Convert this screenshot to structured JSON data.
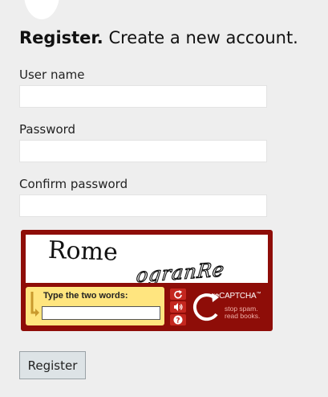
{
  "header": {
    "title_strong": "Register.",
    "title_rest": " Create a new account."
  },
  "form": {
    "username_label": "User name",
    "username_value": "",
    "password_label": "Password",
    "password_value": "",
    "confirm_label": "Confirm password",
    "confirm_value": "",
    "submit_label": "Register"
  },
  "captcha": {
    "word_1": "Rome",
    "word_2": "ogranRe",
    "prompt": "Type the two words:",
    "response_value": "",
    "brand_prefix": "re",
    "brand_main": "CAPTCHA",
    "brand_tm": "™",
    "slogan_line_1": "stop spam.",
    "slogan_line_2": "read books.",
    "controls": [
      "refresh-icon",
      "audio-icon",
      "help-icon"
    ],
    "colors": {
      "frame": "#8e0d08",
      "entry_bg": "#ffe57f",
      "control_bg": "#c4271f"
    }
  }
}
